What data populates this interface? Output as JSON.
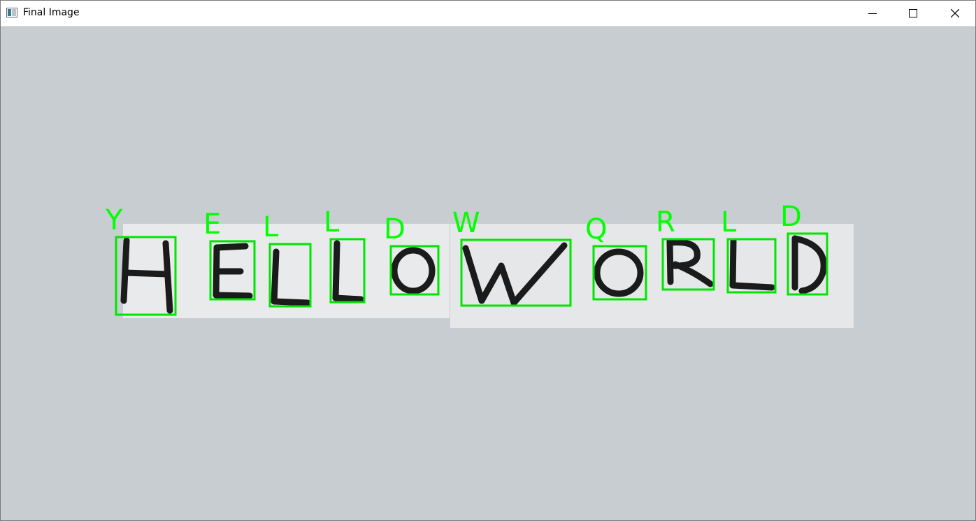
{
  "window": {
    "title": "Final Image",
    "controls": [
      "minimize",
      "maximize",
      "close"
    ]
  },
  "colors": {
    "canvas_bg": "#c8cdd1",
    "paper": "#e8e9eb",
    "ink": "#1a1a1a",
    "box": "#00ff00",
    "label": "#00ff00"
  },
  "detections": [
    {
      "letter": "H",
      "predicted": "Y"
    },
    {
      "letter": "E",
      "predicted": "E"
    },
    {
      "letter": "L",
      "predicted": "L"
    },
    {
      "letter": "L",
      "predicted": "L"
    },
    {
      "letter": "O",
      "predicted": "D"
    },
    {
      "letter": "W",
      "predicted": "W"
    },
    {
      "letter": "O",
      "predicted": "Q"
    },
    {
      "letter": "R",
      "predicted": "R"
    },
    {
      "letter": "L",
      "predicted": "L"
    },
    {
      "letter": "D",
      "predicted": "D"
    }
  ]
}
